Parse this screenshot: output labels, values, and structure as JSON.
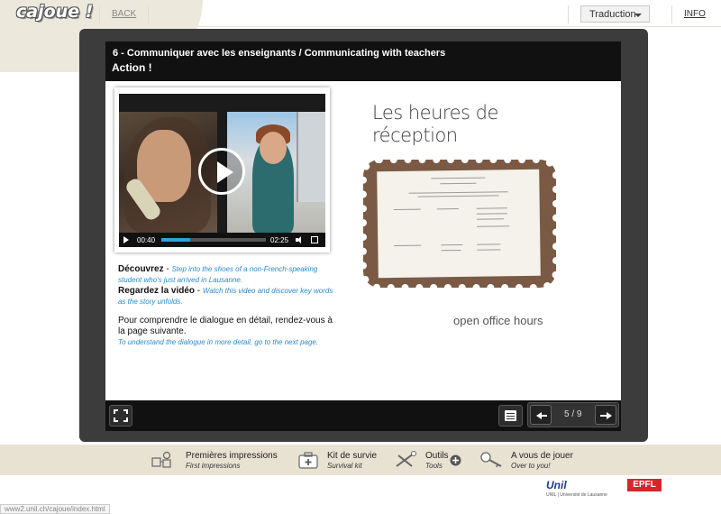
{
  "header": {
    "logo": "cajoue !",
    "back_label": "BACK",
    "translation_label": "Traduction",
    "info_label": "INFO"
  },
  "lesson": {
    "chapter_title": "6 - Communiquer avec les enseignants / Communicating with teachers",
    "section_title": "Action !"
  },
  "video": {
    "current_time": "00:40",
    "duration": "02:25",
    "progress": 0.28
  },
  "instructions": {
    "discover_title": "Découvrez",
    "discover_en": "Step into the shoes of a non-French-speaking student who's just arrived in Lausanne.",
    "watch_title": "Regardez la vidéo",
    "watch_en": "Watch this video and discover key words as the story unfolds.",
    "next_fr": "Pour comprendre le dialogue en détail, rendez-vous à la page suivante.",
    "next_en": "To understand the dialogue in more detail, go to the next page."
  },
  "illustration": {
    "handwritten_title_line1": "Les heures de",
    "handwritten_title_line2": "réception",
    "caption": "open office hours"
  },
  "pager": {
    "page_indicator": "5 / 9"
  },
  "bottom_nav": [
    {
      "label": "Premières impressions",
      "sub": "First impressions",
      "icon": "people-icon"
    },
    {
      "label": "Kit de survie",
      "sub": "Survival kit",
      "icon": "first-aid-kit-icon"
    },
    {
      "label": "Outils",
      "sub": "Tools",
      "icon": "tools-icon"
    },
    {
      "label": "A vous de jouer",
      "sub": "Over to you!",
      "icon": "key-icon"
    }
  ],
  "footer": {
    "unil_logo": "Unil",
    "unil_sub": "UNIL | Université de Lausanne",
    "epfl_logo": "EPFL",
    "status_url": "www2.unil.ch/cajoue/index.html"
  }
}
